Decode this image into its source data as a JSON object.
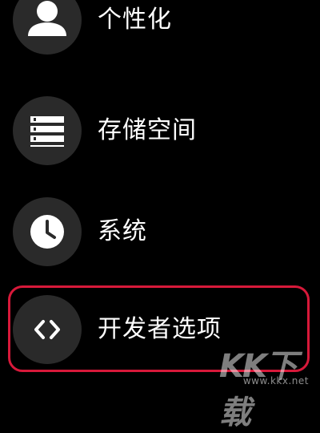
{
  "menu": {
    "items": [
      {
        "label": "个性化",
        "icon": "person-icon"
      },
      {
        "label": "存储空间",
        "icon": "storage-list-icon"
      },
      {
        "label": "系统",
        "icon": "clock-icon"
      },
      {
        "label": "开发者选项",
        "icon": "code-brackets-icon",
        "highlighted": true
      }
    ]
  },
  "colors": {
    "background": "#000000",
    "icon_circle": "#2a2a2a",
    "highlight_border": "#d7193a",
    "text": "#ffffff"
  },
  "watermark": {
    "main": "KK下载",
    "sub": "www.kkx.net"
  }
}
